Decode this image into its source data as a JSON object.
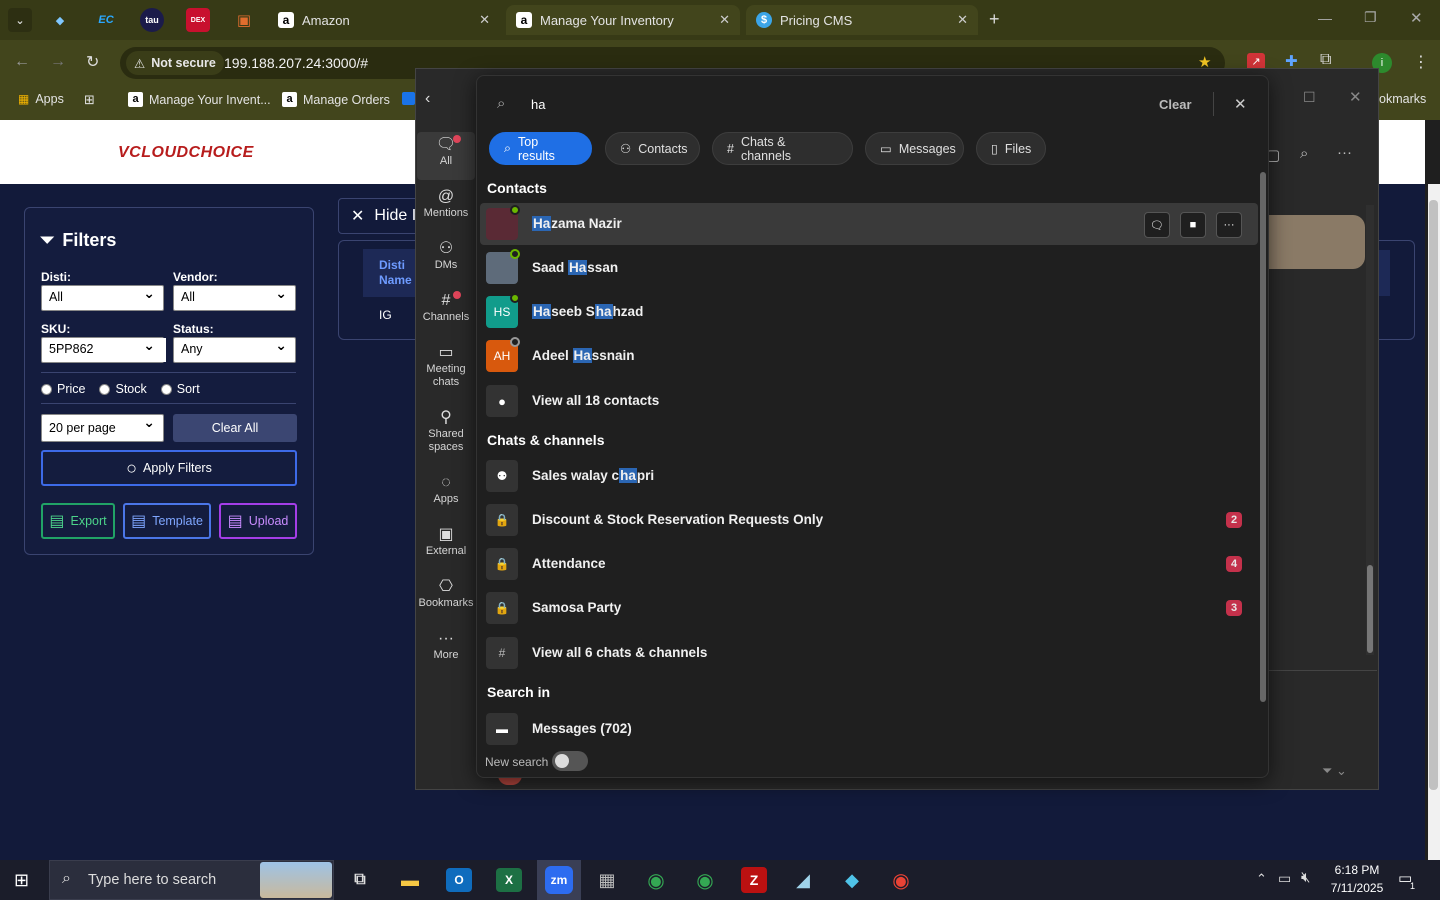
{
  "browser": {
    "tabs": [
      {
        "label": "Amazon",
        "icon": "a"
      },
      {
        "label": "Manage Your Inventory",
        "icon": "a"
      },
      {
        "label": "Pricing CMS",
        "icon": "$"
      }
    ],
    "pinned_icons": [
      "EC",
      "tau",
      "DEX"
    ],
    "security_label": "Not secure",
    "url": "199.188.207.24:3000/#",
    "profile_initial": "i",
    "bookmarks": {
      "apps": "Apps",
      "items": [
        "Manage Your Invent...",
        "Manage Orders"
      ],
      "overflow": "okmarks"
    }
  },
  "page": {
    "logo": "VCLOUDCHOICE",
    "hide_label": "Hide I",
    "filters": {
      "title": "Filters",
      "disti_label": "Disti:",
      "disti_value": "All",
      "vendor_label": "Vendor:",
      "vendor_value": "All",
      "sku_label": "SKU:",
      "sku_value": "5PP862",
      "status_label": "Status:",
      "status_value": "Any",
      "radios": [
        "Price",
        "Stock",
        "Sort"
      ],
      "per_page": "20 per page",
      "clear_all": "Clear All",
      "apply": "Apply Filters",
      "export": "Export",
      "template": "Template",
      "upload": "Upload"
    },
    "table": {
      "col_header_1": "Disti",
      "col_header_2": "Name",
      "cell": "IG"
    }
  },
  "rail": [
    {
      "label": "All",
      "icon": "chat"
    },
    {
      "label": "Mentions",
      "icon": "@"
    },
    {
      "label": "DMs",
      "icon": "people"
    },
    {
      "label": "Channels",
      "icon": "#"
    },
    {
      "label": "Meeting chats",
      "icon": "calendar"
    },
    {
      "label": "Shared spaces",
      "icon": "share"
    },
    {
      "label": "Apps",
      "icon": "apps"
    },
    {
      "label": "External",
      "icon": "contact"
    },
    {
      "label": "Bookmarks",
      "icon": "bookmark"
    },
    {
      "label": "More",
      "icon": "dots"
    }
  ],
  "search": {
    "query": "ha",
    "clear": "Clear",
    "chips": [
      "Top results",
      "Contacts",
      "Chats & channels",
      "Messages",
      "Files"
    ],
    "contacts_title": "Contacts",
    "contacts": [
      {
        "pre": "",
        "hl": "Ha",
        "post": "zama Nazir",
        "initials": ""
      },
      {
        "pre": "Saad ",
        "hl": "Ha",
        "post": "ssan",
        "initials": ""
      },
      {
        "pre": "",
        "hl": "Ha",
        "mid": "seeb S",
        "hl2": "ha",
        "post": "hzad",
        "initials": "HS"
      },
      {
        "pre": "Adeel ",
        "hl": "Ha",
        "post": "ssnain",
        "initials": "AH"
      }
    ],
    "view_all_contacts": "View all 18 contacts",
    "chats_title": "Chats & channels",
    "chats": [
      {
        "pre": "Sales walay c",
        "hl": "ha",
        "post": "pri",
        "badge": ""
      },
      {
        "pre": "Discount & Stock Reservation Requests Only",
        "hl": "",
        "post": "",
        "badge": "2"
      },
      {
        "pre": "Attendance",
        "hl": "",
        "post": "",
        "badge": "4"
      },
      {
        "pre": "Samosa Party",
        "hl": "",
        "post": "",
        "badge": "3"
      }
    ],
    "view_all_chats": "View all 6 chats & channels",
    "search_in_title": "Search in",
    "messages_row": "Messages (702)",
    "new_search": "New search"
  },
  "taskbar": {
    "search_placeholder": "Type here to search",
    "time": "6:18 PM",
    "date": "7/11/2025",
    "notif_count": "1"
  },
  "colors": {
    "accent": "#1f6fe5",
    "badge": "#c4314b",
    "page_bg": "#121a3a"
  }
}
